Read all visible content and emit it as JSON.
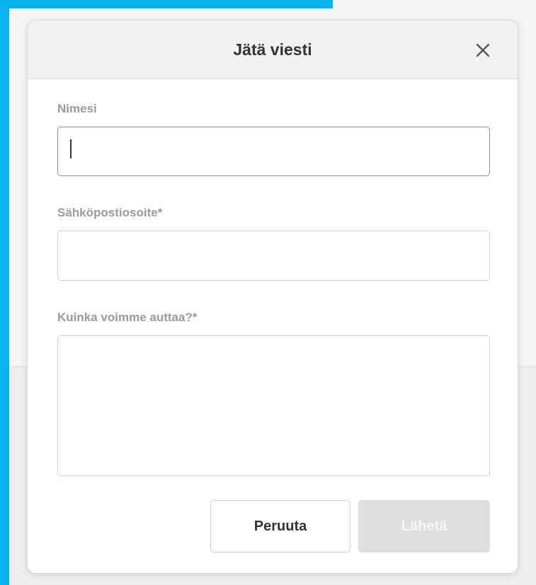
{
  "dialog": {
    "title": "Jätä viesti",
    "close_icon": "close-icon"
  },
  "form": {
    "name": {
      "label": "Nimesi",
      "value": ""
    },
    "email": {
      "label": "Sähköpostiosoite*",
      "value": ""
    },
    "message": {
      "label": "Kuinka voimme auttaa?*",
      "value": ""
    }
  },
  "buttons": {
    "cancel": "Peruuta",
    "send": "Lähetä"
  },
  "colors": {
    "accent": "#08b2ea",
    "send_disabled": "#dedede"
  }
}
